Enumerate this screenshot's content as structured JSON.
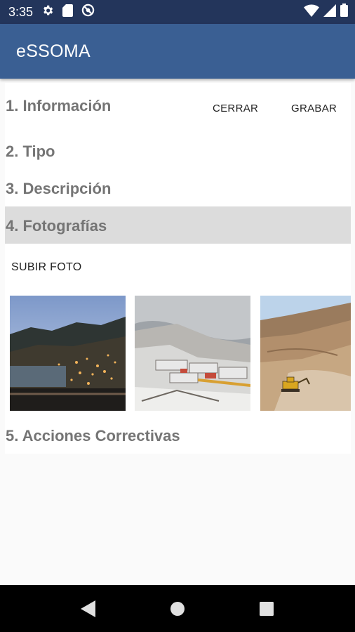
{
  "status_bar": {
    "time": "3:35",
    "left_icons": [
      "gear-icon",
      "sd-card-icon",
      "no-sync-icon"
    ],
    "right_icons": [
      "wifi-icon",
      "signal-icon",
      "battery-icon"
    ]
  },
  "app_bar": {
    "title": "eSSOMA",
    "color": "#3a5f93"
  },
  "steps": [
    {
      "label": "1. Información"
    },
    {
      "label": "2. Tipo"
    },
    {
      "label": "3. Descripción"
    },
    {
      "label": "4. Fotografías",
      "active": true
    },
    {
      "label": "5. Acciones Correctivas"
    }
  ],
  "actions": {
    "close_label": "CERRAR",
    "save_label": "GRABAR"
  },
  "photos_section": {
    "upload_label": "SUBIR FOTO",
    "thumbnails": [
      "mining-town-night-photo",
      "snowy-camp-photo",
      "quarry-excavator-photo"
    ]
  },
  "nav_bar": {
    "buttons": [
      "back-icon",
      "home-icon",
      "recents-icon"
    ]
  }
}
